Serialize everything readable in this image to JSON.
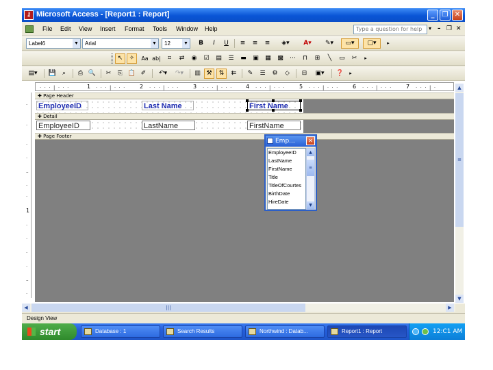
{
  "window": {
    "title": "Microsoft Access - [Report1 : Report]",
    "app_icon": "access-key-icon",
    "buttons": {
      "minimize": "_",
      "restore": "❐",
      "close": "✕"
    }
  },
  "menubar": {
    "items": [
      "File",
      "Edit",
      "View",
      "Insert",
      "Format",
      "Tools",
      "Window",
      "Help"
    ],
    "ask_placeholder": "Type a question for help",
    "ask_arrow": "▾",
    "mdi_minimize": "–",
    "mdi_restore": "❐",
    "mdi_close": "✕"
  },
  "formatting_toolbar": {
    "object": "Label6",
    "font": "Arial",
    "size": "12",
    "bold": "B",
    "italic": "I",
    "underline": "U"
  },
  "toolbox": {
    "items": [
      "select-icon",
      "wizard-icon",
      "label-icon",
      "textbox-icon",
      "option-group-icon",
      "toggle-icon",
      "option-button-icon",
      "checkbox-icon",
      "combo-icon",
      "listbox-icon",
      "command-icon",
      "image-icon",
      "unbound-frame-icon",
      "bound-frame-icon",
      "page-break-icon",
      "tab-control-icon",
      "subreport-icon",
      "line-icon",
      "rectangle-icon",
      "more-controls-icon"
    ]
  },
  "ruler": {
    "labels": [
      "1",
      "2",
      "3",
      "4",
      "5",
      "6",
      "7"
    ],
    "vertical_labels": [
      "1"
    ]
  },
  "sections": {
    "page_header": "Page Header",
    "detail": "Detail",
    "page_footer": "Page Footer"
  },
  "controls": {
    "header_labels": [
      "EmployeeID",
      "Last Name",
      "First Name"
    ],
    "detail_fields": [
      "EmployeeID",
      "LastName",
      "FirstName"
    ]
  },
  "field_list": {
    "title": "Emp...",
    "fields": [
      "EmployeeID",
      "LastName",
      "FirstName",
      "Title",
      "TitleOfCourtes",
      "BirthDate",
      "HireDate"
    ]
  },
  "statusbar": {
    "text": "Design View"
  },
  "taskbar": {
    "start": "start",
    "tasks": [
      {
        "label": "Database : 1",
        "active": false
      },
      {
        "label": "Search Results",
        "active": false
      },
      {
        "label": "Northwind : Datab...",
        "active": false
      },
      {
        "label": "Report1 : Report",
        "active": true
      }
    ],
    "clock": "12:C1 AM"
  },
  "colors": {
    "titlebar": "#0a55d6",
    "label_text": "#1d2bb0",
    "design_background": "#808080",
    "taskbar": "#245edb"
  }
}
